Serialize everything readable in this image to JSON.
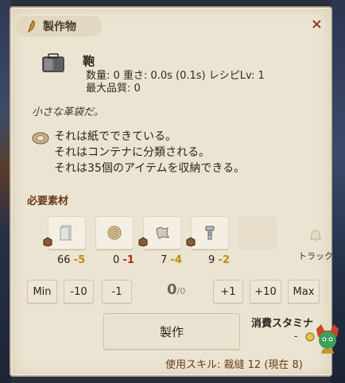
{
  "window": {
    "title": "製作物",
    "close_label": "×"
  },
  "item": {
    "name": "鞄",
    "stats_line1": "数量: 0  重さ: 0.0s (0.1s)  レシピLv: 1",
    "stats_line2": "最大品質: 0",
    "description": "小さな革袋だ。",
    "properties": [
      "それは紙でできている。",
      "それはコンテナに分類される。",
      "それは35個のアイテムを収納できる。"
    ]
  },
  "materials": {
    "label": "必要素材",
    "items": [
      {
        "icon": "paper-icon",
        "have": "66",
        "need": "-5"
      },
      {
        "icon": "rope-coil-icon",
        "have": "0",
        "need": "-1"
      },
      {
        "icon": "leather-scrap-icon",
        "have": "7",
        "need": "-4"
      },
      {
        "icon": "bolt-icon",
        "have": "9",
        "need": "-2"
      }
    ],
    "track_label": "トラック"
  },
  "quantity": {
    "buttons": [
      "Min",
      "-10",
      "-1",
      "+1",
      "+10",
      "Max"
    ],
    "current": "0",
    "max": "/0"
  },
  "craft": {
    "button_label": "製作",
    "stamina_label": "消費スタミナ",
    "stamina_value": "-",
    "skill_line": "使用スキル: 裁縫 12 (現在 8)"
  },
  "colors": {
    "panel_bg": "#ece4d2",
    "accent_brown": "#6a3a18",
    "need_yellow": "#c08a10",
    "need_red": "#b22a1a"
  }
}
